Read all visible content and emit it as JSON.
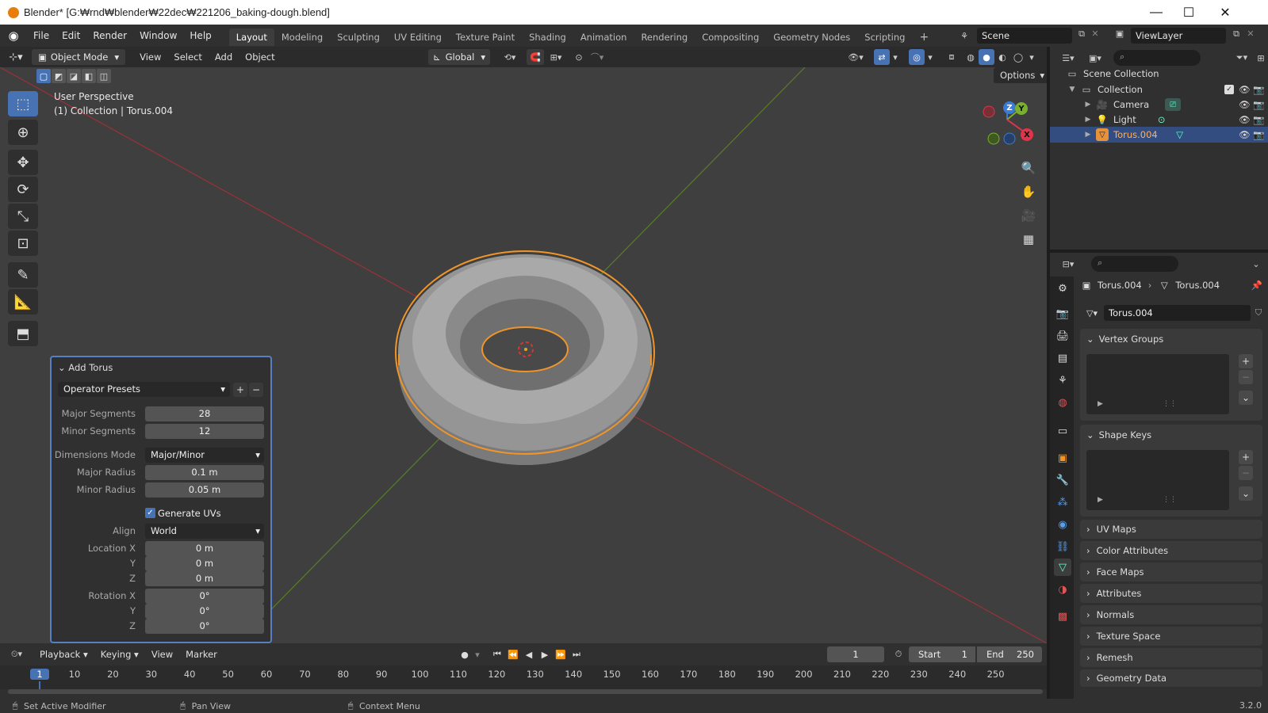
{
  "window": {
    "title": "Blender* [G:₩rnd₩blender₩22dec₩221206_baking-dough.blend]",
    "minimize": "—",
    "maximize": "☐",
    "close": "✕"
  },
  "menu": [
    "File",
    "Edit",
    "Render",
    "Window",
    "Help"
  ],
  "workspaces": [
    "Layout",
    "Modeling",
    "Sculpting",
    "UV Editing",
    "Texture Paint",
    "Shading",
    "Animation",
    "Rendering",
    "Compositing",
    "Geometry Nodes",
    "Scripting"
  ],
  "active_workspace": "Layout",
  "scene": {
    "name": "Scene",
    "view_layer": "ViewLayer"
  },
  "viewport_header": {
    "mode": "Object Mode",
    "menus": [
      "View",
      "Select",
      "Add",
      "Object"
    ],
    "transform_orientation": "Global",
    "options": "Options"
  },
  "viewport": {
    "perspective": "User Perspective",
    "context": "(1) Collection | Torus.004",
    "gizmo": {
      "z": "Z",
      "y": "Y",
      "x": "X"
    }
  },
  "redo_panel": {
    "title": "Add Torus",
    "presets": "Operator Presets",
    "major_segments_label": "Major Segments",
    "major_segments": "28",
    "minor_segments_label": "Minor Segments",
    "minor_segments": "12",
    "dimensions_mode_label": "Dimensions Mode",
    "dimensions_mode": "Major/Minor",
    "major_radius_label": "Major Radius",
    "major_radius": "0.1 m",
    "minor_radius_label": "Minor Radius",
    "minor_radius": "0.05 m",
    "generate_uvs": "Generate UVs",
    "align_label": "Align",
    "align": "World",
    "location_x_label": "Location X",
    "location_x": "0 m",
    "location_y_label": "Y",
    "location_y": "0 m",
    "location_z_label": "Z",
    "location_z": "0 m",
    "rotation_x_label": "Rotation X",
    "rotation_x": "0°",
    "rotation_y_label": "Y",
    "rotation_y": "0°",
    "rotation_z_label": "Z",
    "rotation_z": "0°"
  },
  "timeline": {
    "menus": [
      "Playback",
      "Keying",
      "View",
      "Marker"
    ],
    "current_frame": "1",
    "start_label": "Start",
    "start": "1",
    "end_label": "End",
    "end": "250",
    "ruler": [
      "1",
      "10",
      "20",
      "30",
      "40",
      "50",
      "60",
      "70",
      "80",
      "90",
      "100",
      "110",
      "120",
      "130",
      "140",
      "150",
      "160",
      "170",
      "180",
      "190",
      "200",
      "210",
      "220",
      "230",
      "240",
      "250"
    ]
  },
  "outliner": {
    "root": "Scene Collection",
    "collection": "Collection",
    "items": [
      "Camera",
      "Light",
      "Torus.004"
    ]
  },
  "properties": {
    "breadcrumb_object": "Torus.004",
    "breadcrumb_data": "Torus.004",
    "mesh_name": "Torus.004",
    "panels_open": [
      "Vertex Groups",
      "Shape Keys"
    ],
    "panels_closed": [
      "UV Maps",
      "Color Attributes",
      "Face Maps",
      "Attributes",
      "Normals",
      "Texture Space",
      "Remesh",
      "Geometry Data"
    ]
  },
  "statusbar": {
    "left": "Set Active Modifier",
    "middle": "Pan View",
    "right": "Context Menu",
    "version": "3.2.0"
  },
  "colors": {
    "accent": "#4772b3",
    "selection_outline": "#f0952a",
    "x_axis": "#c8303a",
    "y_axis": "#6fa12a"
  }
}
